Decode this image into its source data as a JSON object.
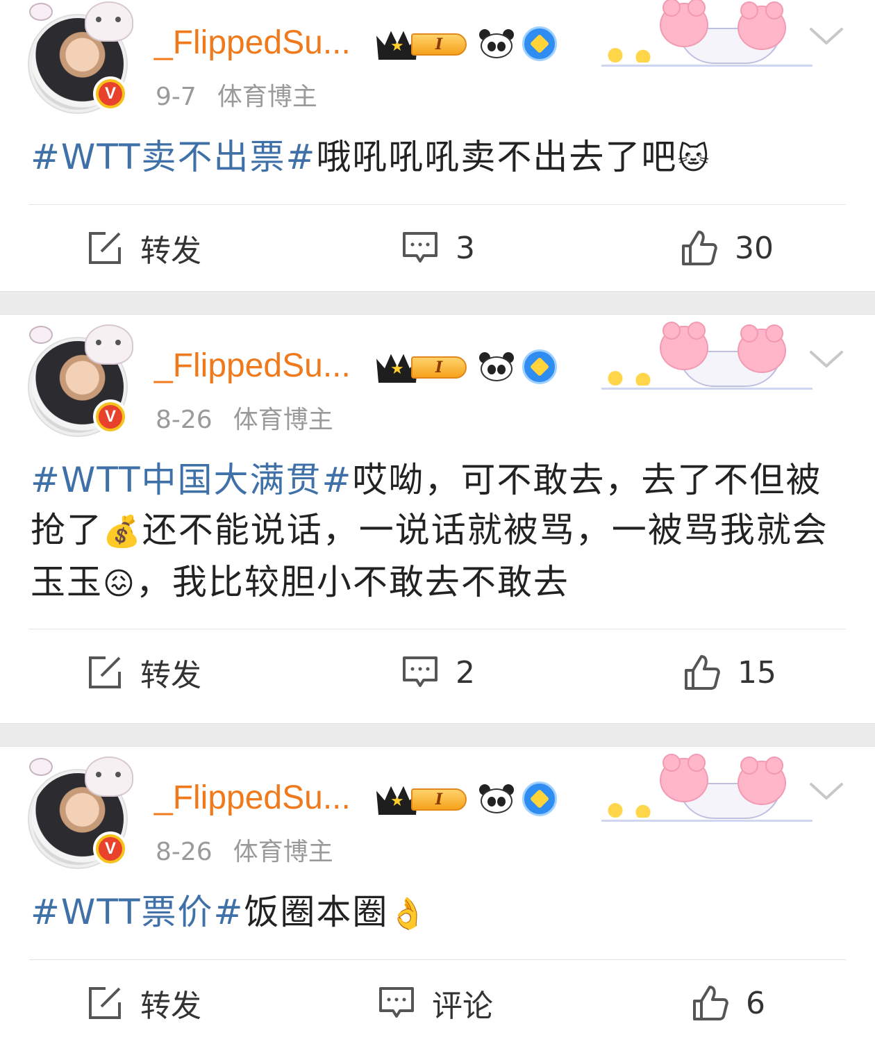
{
  "posts": [
    {
      "username": "_FlippedSu...",
      "level_badge": "I",
      "date": "9-7",
      "role": "体育博主",
      "hashtag": "#WTT卖不出票#",
      "text": "哦吼吼吼卖不出去了吧",
      "emoji_end": "🐱",
      "repost_label": "转发",
      "comment_count": "3",
      "like_count": "30"
    },
    {
      "username": "_FlippedSu...",
      "level_badge": "I",
      "date": "8-26",
      "role": "体育博主",
      "hashtag": "#WTT中国大满贯#",
      "text_part1": "哎呦，可不敢去，去了不但被抢了",
      "emoji_money": "💰",
      "text_part2": "还不能说话，一说话就被骂，一被骂我就会玉玉",
      "emoji_sad": "😖",
      "text_part3": "，我比较胆小不敢去不敢去",
      "repost_label": "转发",
      "comment_count": "2",
      "like_count": "15"
    },
    {
      "username": "_FlippedSu...",
      "level_badge": "I",
      "date": "8-26",
      "role": "体育博主",
      "hashtag": "#WTT票价#",
      "text": "饭圈本圈",
      "emoji_end": "👌",
      "repost_label": "转发",
      "comment_label": "评论",
      "like_count": "6"
    }
  ],
  "icons": {
    "repost": "repost-icon",
    "comment": "comment-icon",
    "like": "thumbs-up-icon",
    "more": "chevron-down-icon"
  },
  "colors": {
    "username": "#f07a1b",
    "hashtag": "#3f71a8",
    "meta": "#9a9a9a",
    "verified": "#e8412c"
  }
}
